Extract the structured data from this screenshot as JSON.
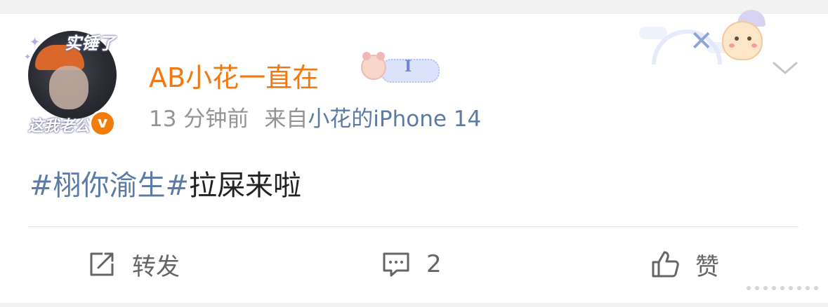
{
  "post": {
    "username": "AB小花一直在",
    "avatar_caption_top": "实锤了",
    "avatar_caption_bottom": "这我老公",
    "verified_symbol": "v",
    "badge_letter": "I",
    "time": "13 分钟前",
    "source_prefix": "来自",
    "source_device": "小花的iPhone 14",
    "text": {
      "hashtag": "#栩你渝生#",
      "body": "拉屎来啦"
    }
  },
  "actions": {
    "repost_label": "转发",
    "comment_count": "2",
    "like_label": "赞"
  },
  "icons": {
    "menu": "chevron-down-icon",
    "repost": "share-icon",
    "comment": "comment-icon",
    "like": "thumbs-up-icon",
    "verified": "verified-badge-icon",
    "card_decoration": "bunny-windmill-decoration",
    "more": "more-dots-icon"
  },
  "colors": {
    "username": "#ef7a13",
    "link": "#5b7aa6",
    "meta": "#939393",
    "verified": "#f27c0a",
    "action": "#656565",
    "background": "#f2f2f2",
    "card": "#ffffff"
  }
}
